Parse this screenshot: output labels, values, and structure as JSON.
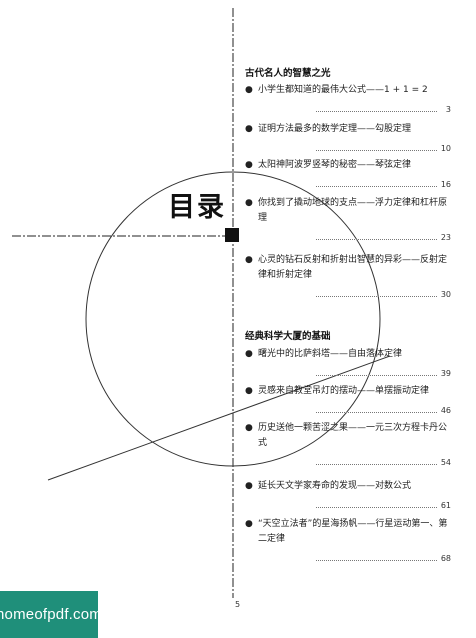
{
  "toc_title": "目录",
  "sections": [
    {
      "heading": "古代名人的智慧之光",
      "entries": [
        {
          "title": "小学生都知道的最伟大公式——1 + 1 = 2",
          "page": "3"
        },
        {
          "title": "证明方法最多的数学定理——勾股定理",
          "page": "10"
        },
        {
          "title": "太阳神阿波罗竖琴的秘密——琴弦定律",
          "page": "16"
        },
        {
          "title": "你找到了撬动地球的支点——浮力定律和杠杆原理",
          "page": "23"
        },
        {
          "title": "心灵的钻石反射和折射出智慧的异彩——反射定律和折射定律",
          "page": "30"
        }
      ]
    },
    {
      "heading": "经典科学大厦的基础",
      "entries": [
        {
          "title": "曙光中的比萨斜塔——自由落体定律",
          "page": "39"
        },
        {
          "title": "灵感来自教堂吊灯的摆动——单摆振动定律",
          "page": "46"
        },
        {
          "title": "历史送他一颗苦涩之果——一元三次方程卡丹公式",
          "page": "54"
        },
        {
          "title": "延长天文学家寿命的发现——对数公式",
          "page": "61"
        },
        {
          "title": "“天空立法者”的星海扬帆——行星运动第一、第二定律",
          "page": "68"
        }
      ]
    }
  ],
  "folio": "5",
  "watermark": "homeofpdf.com",
  "colors": {
    "watermark_bg": "#1f8f7a",
    "watermark_text": "#ffffff",
    "ink": "#111111"
  }
}
